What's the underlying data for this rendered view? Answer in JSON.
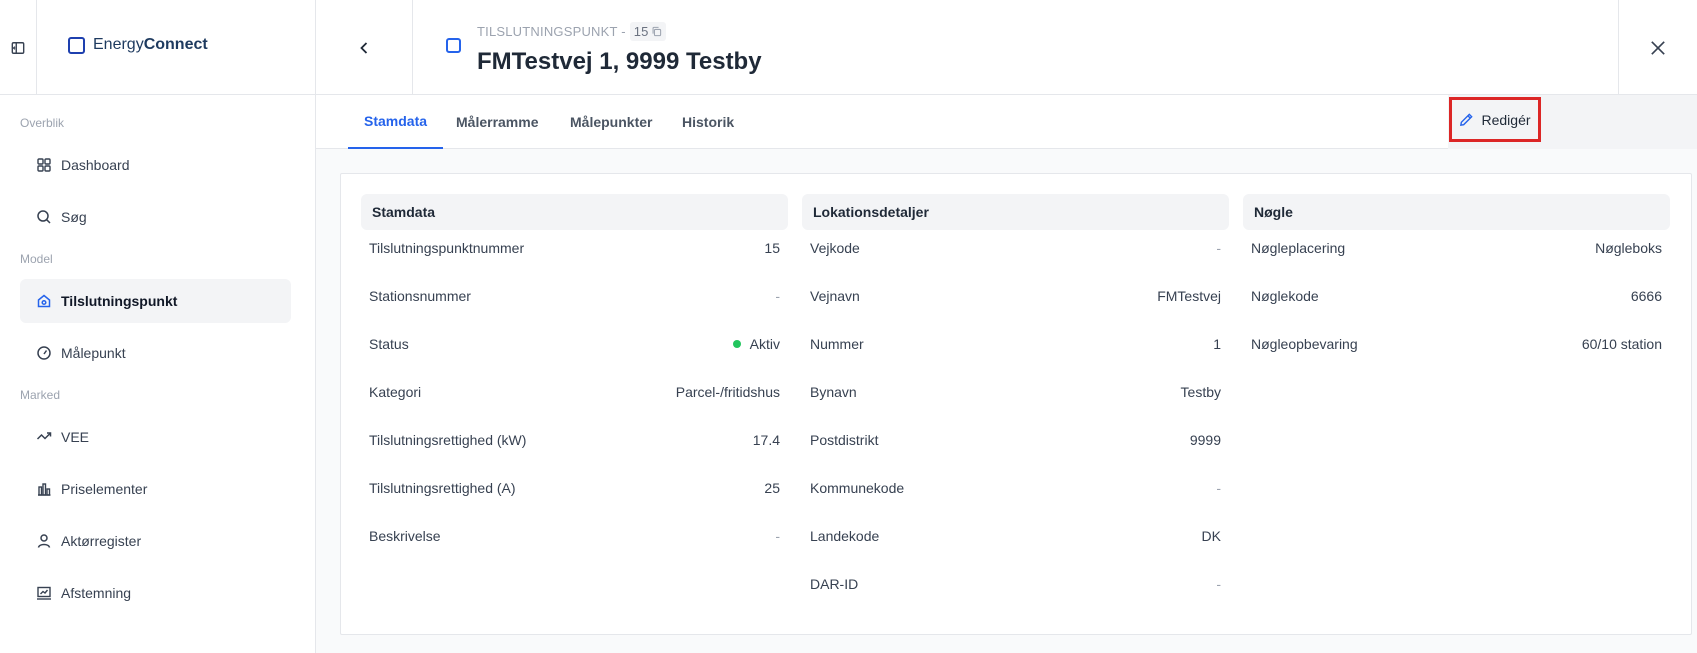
{
  "app": {
    "brand_prefix": "Energy",
    "brand_suffix": "Connect"
  },
  "sidebar": {
    "sections": {
      "overblik": "Overblik",
      "model": "Model",
      "marked": "Marked"
    },
    "items": [
      {
        "label": "Dashboard",
        "icon": "grid-icon"
      },
      {
        "label": "Søg",
        "icon": "search-icon"
      },
      {
        "label": "Tilslutningspunkt",
        "icon": "home-icon",
        "active": true
      },
      {
        "label": "Målepunkt",
        "icon": "gauge-icon"
      },
      {
        "label": "VEE",
        "icon": "trend-icon"
      },
      {
        "label": "Priselementer",
        "icon": "bar-chart-icon"
      },
      {
        "label": "Aktørregister",
        "icon": "user-icon"
      },
      {
        "label": "Afstemning",
        "icon": "presentation-icon"
      }
    ]
  },
  "header": {
    "subtitle": "TILSLUTNINGSPUNKT -",
    "id": "15",
    "title": "FMTestvej 1, 9999 Testby"
  },
  "tabs": [
    "Stamdata",
    "Målerramme",
    "Målepunkter",
    "Historik"
  ],
  "edit_label": "Redigér",
  "columns": {
    "stamdata": {
      "title": "Stamdata",
      "rows": [
        {
          "label": "Tilslutningspunktnummer",
          "value": "15"
        },
        {
          "label": "Stationsnummer",
          "value": "-"
        },
        {
          "label": "Status",
          "value": "Aktiv"
        },
        {
          "label": "Kategori",
          "value": "Parcel-/fritidshus"
        },
        {
          "label": "Tilslutningsrettighed (kW)",
          "value": "17.4"
        },
        {
          "label": "Tilslutningsrettighed (A)",
          "value": "25"
        },
        {
          "label": "Beskrivelse",
          "value": "-"
        }
      ]
    },
    "lokation": {
      "title": "Lokationsdetaljer",
      "rows": [
        {
          "label": "Vejkode",
          "value": "-"
        },
        {
          "label": "Vejnavn",
          "value": "FMTestvej"
        },
        {
          "label": "Nummer",
          "value": "1"
        },
        {
          "label": "Bynavn",
          "value": "Testby"
        },
        {
          "label": "Postdistrikt",
          "value": "9999"
        },
        {
          "label": "Kommunekode",
          "value": "-"
        },
        {
          "label": "Landekode",
          "value": "DK"
        },
        {
          "label": "DAR-ID",
          "value": "-"
        }
      ]
    },
    "noegle": {
      "title": "Nøgle",
      "rows": [
        {
          "label": "Nøgleplacering",
          "value": "Nøgleboks"
        },
        {
          "label": "Nøglekode",
          "value": "6666"
        },
        {
          "label": "Nøgleopbevaring",
          "value": "60/10 station"
        }
      ]
    }
  },
  "colors": {
    "accent": "#2563eb",
    "status_active": "#22c55e",
    "highlight": "#dc2626"
  }
}
